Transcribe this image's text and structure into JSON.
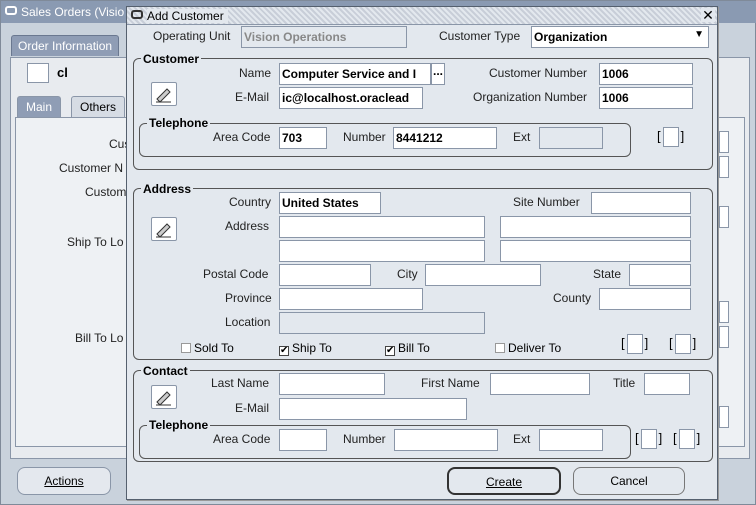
{
  "background_window": {
    "title": "Sales Orders (Visio",
    "tab_order_information": "Order Information",
    "header_value": "cl",
    "subtabs": [
      "Main",
      "Others"
    ],
    "labels": [
      "Cus",
      "Customer N",
      "Custom",
      "Ship To Lo",
      "Bill To Lo"
    ],
    "actions_button": "Actions"
  },
  "dialog": {
    "title": "Add Customer",
    "operating_unit_label": "Operating Unit",
    "operating_unit_value": "Vision Operations",
    "customer_type_label": "Customer Type",
    "customer_type_value": "Organization",
    "customer": {
      "section_title": "Customer",
      "name_label": "Name",
      "name_value": "Computer Service and I",
      "email_label": "E-Mail",
      "email_value": "ic@localhost.oraclead",
      "customer_number_label": "Customer Number",
      "customer_number_value": "1006",
      "organization_number_label": "Organization Number",
      "organization_number_value": "1006",
      "lov_button": "...",
      "telephone": {
        "section_title": "Telephone",
        "area_code_label": "Area Code",
        "area_code_value": "703",
        "number_label": "Number",
        "number_value": "8441212",
        "ext_label": "Ext",
        "ext_value": ""
      }
    },
    "address": {
      "section_title": "Address",
      "country_label": "Country",
      "country_value": "United States",
      "site_number_label": "Site Number",
      "site_number_value": "",
      "address_label": "Address",
      "postal_code_label": "Postal Code",
      "city_label": "City",
      "state_label": "State",
      "province_label": "Province",
      "county_label": "County",
      "location_label": "Location",
      "checkboxes": [
        {
          "label": "Sold To",
          "accel": "o",
          "checked": false
        },
        {
          "label": "Ship To",
          "accel": "S",
          "checked": true
        },
        {
          "label": "Bill To",
          "accel": "B",
          "checked": true
        },
        {
          "label": "Deliver To",
          "accel": "D",
          "checked": false
        }
      ]
    },
    "contact": {
      "section_title": "Contact",
      "last_name_label": "Last Name",
      "first_name_label": "First Name",
      "title_label": "Title",
      "email_label": "E-Mail",
      "telephone": {
        "section_title": "Telephone",
        "area_code_label": "Area Code",
        "number_label": "Number",
        "ext_label": "Ext"
      }
    },
    "buttons": {
      "create": "Create",
      "cancel": "Cancel"
    },
    "check_mark": "✔",
    "bracket_open": "[",
    "bracket_close": "]"
  }
}
